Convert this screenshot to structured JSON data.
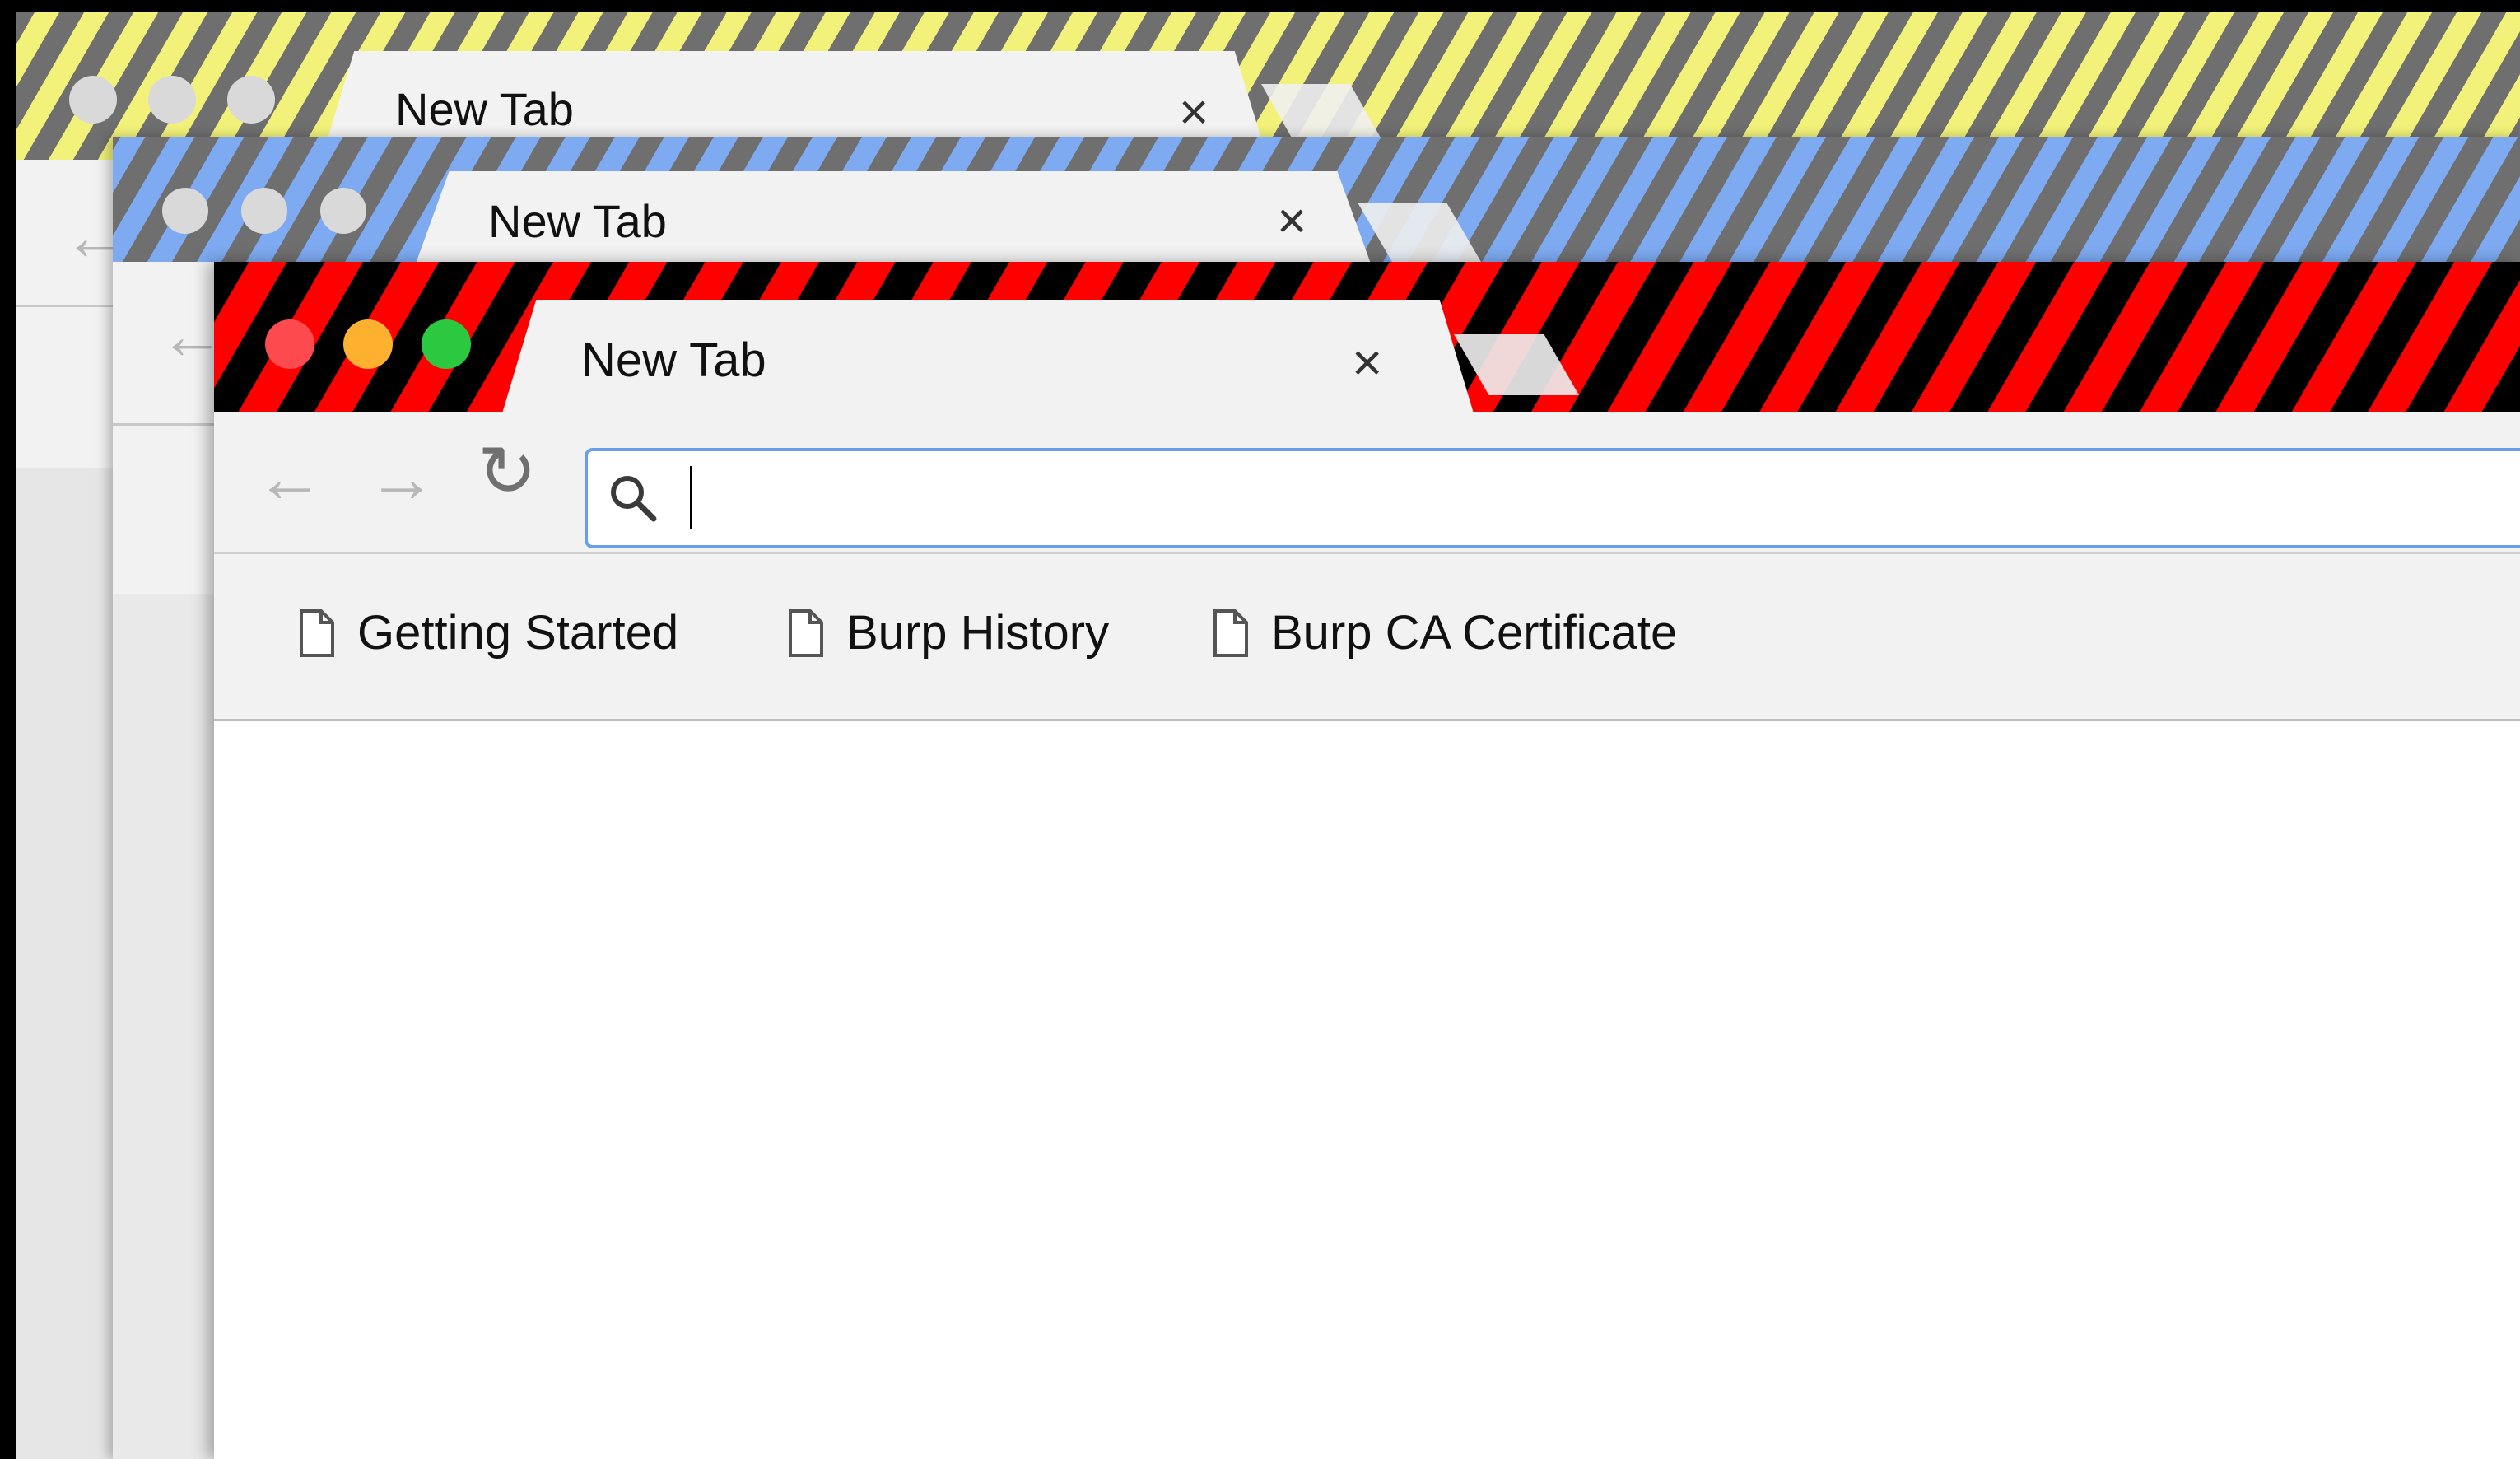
{
  "windows": {
    "back": {
      "tab_title": "New Tab",
      "close_glyph": "×",
      "stripe_colors": [
        "#6f6f6f",
        "#f2f27a"
      ]
    },
    "middle": {
      "tab_title": "New Tab",
      "close_glyph": "×",
      "stripe_colors": [
        "#6f6f6f",
        "#7eaaf2"
      ]
    },
    "front": {
      "tab_title": "New Tab",
      "close_glyph": "×",
      "stripe_colors": [
        "#000000",
        "#ff0000"
      ],
      "traffic_lights": [
        "#fc4a4e",
        "#fdb12e",
        "#2ac940"
      ],
      "toolbar": {
        "back_glyph": "←",
        "forward_glyph": "→",
        "reload_glyph": "↻"
      },
      "omnibox": {
        "value": "",
        "placeholder": "",
        "focus_color": "#6a9ee8"
      },
      "bookmarks": [
        {
          "label": "Getting Started",
          "icon": "page-icon"
        },
        {
          "label": "Burp History",
          "icon": "page-icon"
        },
        {
          "label": "Burp CA Certificate",
          "icon": "page-icon"
        }
      ]
    }
  }
}
